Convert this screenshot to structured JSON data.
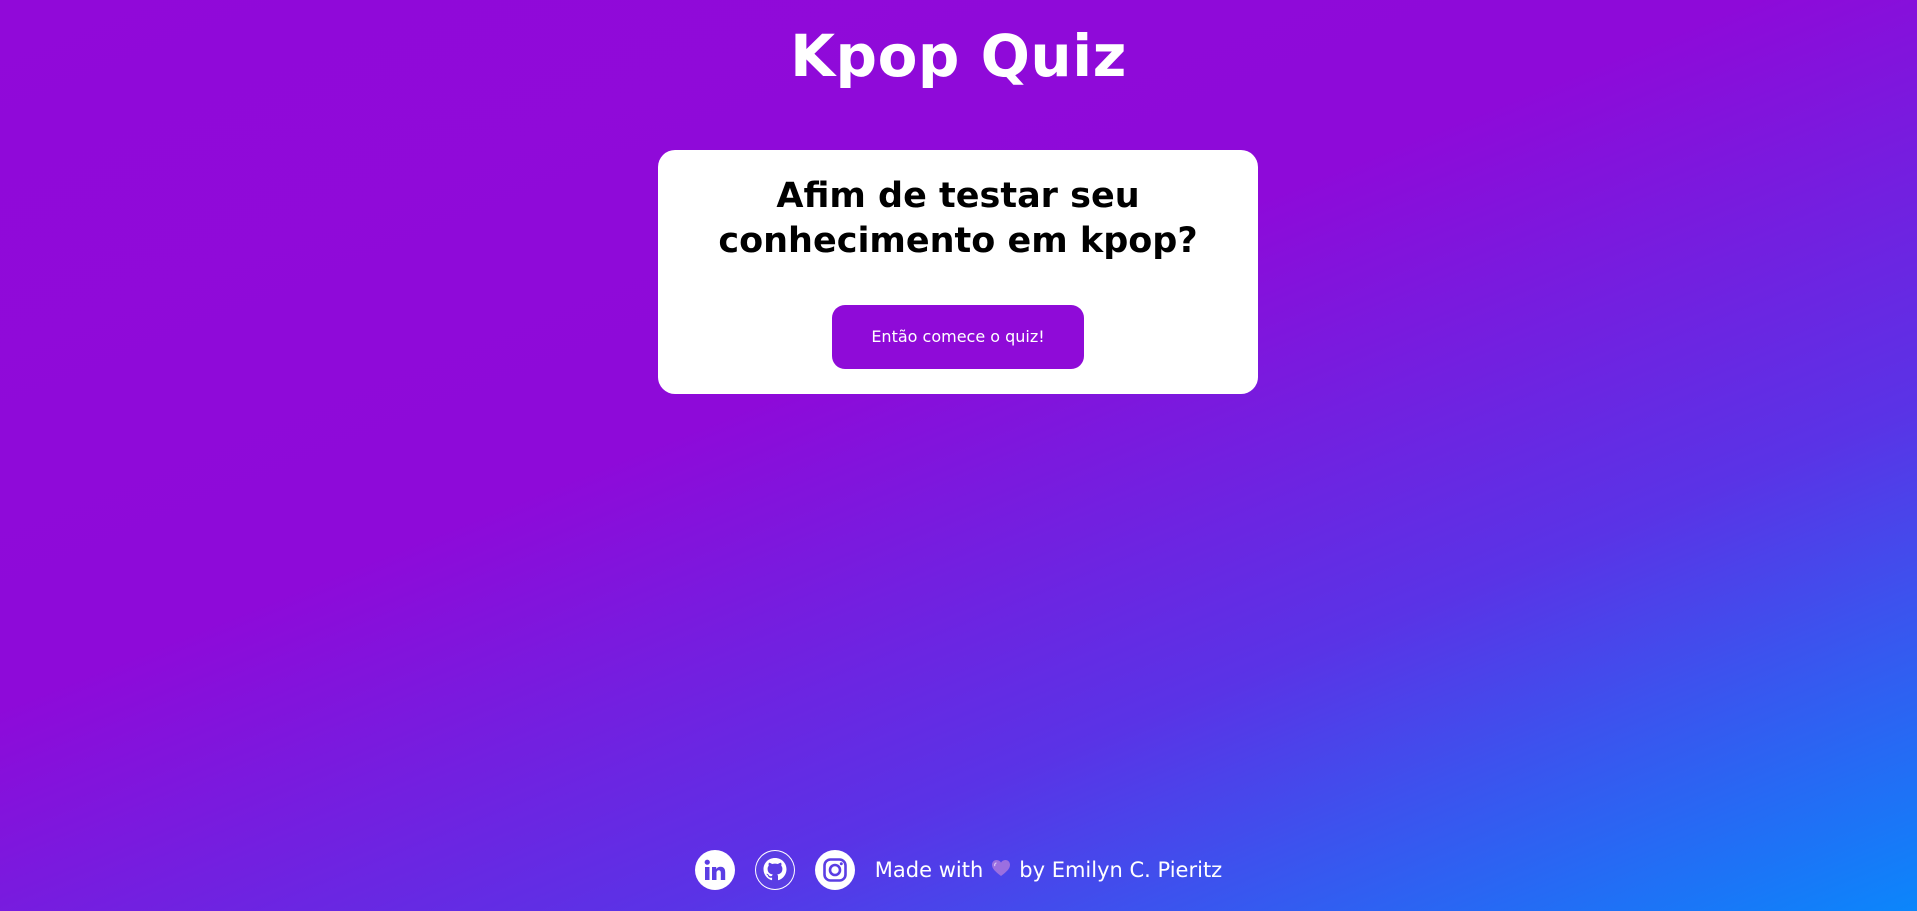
{
  "header": {
    "title": "Kpop Quiz"
  },
  "card": {
    "question": "Afim de testar seu conhecimento em kpop?",
    "start_button_label": "Então comece o quiz!"
  },
  "footer": {
    "social_links": [
      {
        "icon": "linkedin-icon"
      },
      {
        "icon": "github-icon"
      },
      {
        "icon": "instagram-icon"
      }
    ],
    "made_with_text": "Made with",
    "heart_icon": "heart-icon",
    "author_text": "by Emilyn C. Pieritz"
  },
  "colors": {
    "gradient_start": "#9109d9",
    "gradient_end": "#0b86fb",
    "button_bg": "#8f0bd8",
    "heart": "#9b6fe0"
  }
}
